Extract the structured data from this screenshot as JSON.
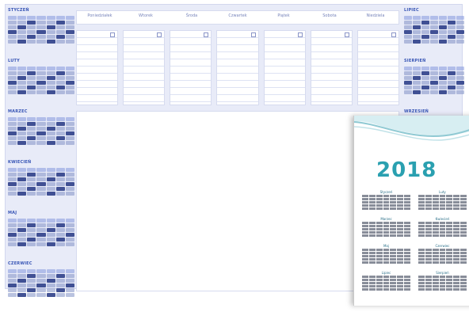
{
  "left_months": [
    "STYCZEŃ",
    "LUTY",
    "MARZEC",
    "KWIECIEŃ",
    "MAJ",
    "CZERWIEC"
  ],
  "right_months": [
    "LIPIEC",
    "SIERPIEŃ",
    "WRZESIEŃ"
  ],
  "week_days": [
    "Poniedziałek",
    "Wtorek",
    "Środa",
    "Czwartek",
    "Piątek",
    "Sobota",
    "Niedziela"
  ],
  "overlay": {
    "year": "2018",
    "months": [
      "Styczeń",
      "Luty",
      "Marzec",
      "Kwiecień",
      "Maj",
      "Czerwiec",
      "Lipiec",
      "Sierpień"
    ]
  },
  "colors": {
    "accent": "#3a57b6",
    "pad_bg": "#e8ebf8",
    "year_teal": "#2aa0b0"
  }
}
